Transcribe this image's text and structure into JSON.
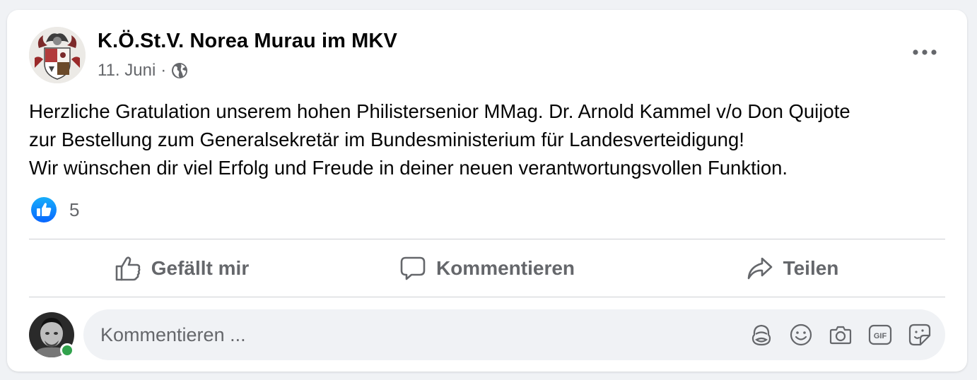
{
  "post": {
    "page_name": "K.Ö.St.V. Norea Murau im MKV",
    "date": "11. Juni",
    "separator": "·",
    "text_lines": [
      "Herzliche Gratulation unserem hohen Philistersenior MMag. Dr. Arnold Kammel v/o Don Quijote",
      "zur Bestellung zum Generalsekretär im Bundesministerium für Landesverteidigung!",
      "Wir wünschen dir viel Erfolg und Freude in deiner neuen verantwortungsvollen Funktion."
    ],
    "like_count": "5"
  },
  "actions": {
    "like_label": "Gefällt mir",
    "comment_label": "Kommentieren",
    "share_label": "Teilen"
  },
  "comment": {
    "placeholder": "Kommentieren ...",
    "tools": [
      "avatar-sticker-icon",
      "emoji-icon",
      "camera-icon",
      "gif-icon",
      "sticker-icon"
    ]
  },
  "colors": {
    "background": "#f0f2f5",
    "card": "#ffffff",
    "secondary_text": "#65676b",
    "like_blue": "#1877f2",
    "online_green": "#31a24c"
  }
}
